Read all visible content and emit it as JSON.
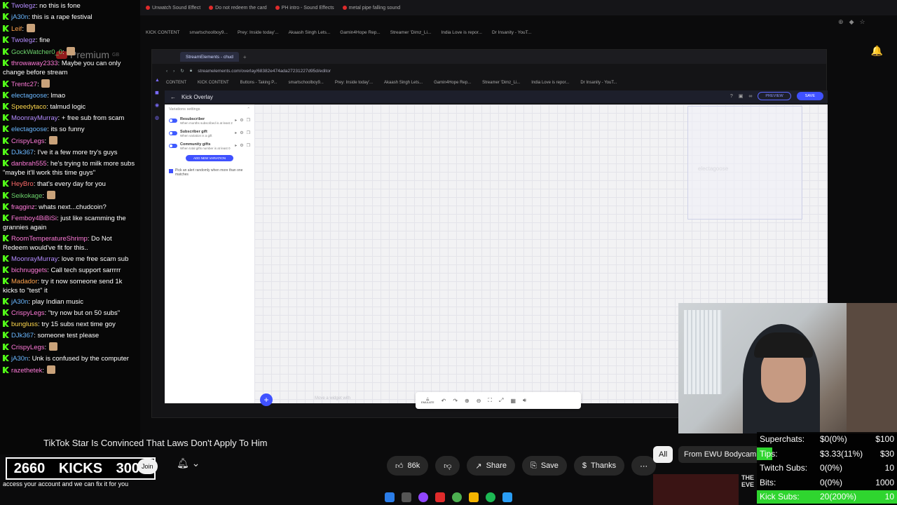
{
  "outer_browser": {
    "tabs": [
      "Unwatch Sound Effect",
      "Do not redeem the card",
      "PH intro - Sound Effects",
      "metal pipe falling sound"
    ],
    "bookmarks": [
      "KICK CONTENT",
      "smartschoolboy9...",
      "Prey: Inside today'...",
      "Akaash Singh Lets...",
      "Gamin4Hope Rep...",
      "Streamer 'Dimz_Li...",
      "India Love is repor...",
      "Dr Insanity - YouT..."
    ],
    "youtube_premium": "Premium",
    "youtube_region": "GB"
  },
  "inner_browser": {
    "tab_title": "StreamElements - chud",
    "url": "streamelements.com/overlay/68382e474ada27231227d95d/editor",
    "bookmarks": [
      "CONTENT",
      "KICK CONTENT",
      "Buttons - Taking P...",
      "smartschoolboy9...",
      "Prey: Inside today'...",
      "Akaash Singh Lets...",
      "Gamin4Hope Rep...",
      "Streamer 'Dimz_Li...",
      "India Love is repor...",
      "Dr Insanity - YouT..."
    ]
  },
  "editor": {
    "title": "Kick Overlay",
    "preview_label": "PREVIEW",
    "save_label": "SAVE",
    "panel_title": "Variations settings",
    "variations": [
      {
        "name": "Resubscriber",
        "desc": "When months subscribed is at least 2"
      },
      {
        "name": "Subscriber gift",
        "desc": "When variation is a gift"
      },
      {
        "name": "Community gifts",
        "desc": "When total gifts number is at least 0"
      }
    ],
    "add_variation_label": "ADD NEW VARIATION",
    "pick_random_label": "Pick an alert randomly when more than one matches",
    "widget_name": "electagoose",
    "canvas_hint": "Move a widget with",
    "emulate_label": "EMULATE"
  },
  "chat": [
    {
      "user": "Twolegz",
      "color": "#b48cff",
      "text": "no this is fone"
    },
    {
      "user": "jA30n",
      "color": "#6ab7ff",
      "text": "this is a rape festival"
    },
    {
      "user": "Leif",
      "color": "#ffa24d",
      "text": ""
    },
    {
      "user": "Twolegz",
      "color": "#b48cff",
      "text": "fine"
    },
    {
      "user": "GockWatcher0_0",
      "color": "#6cd36c",
      "text": ""
    },
    {
      "user": "throwaway2333",
      "color": "#ff7ad9",
      "text": "Maybe you can only change before stream"
    },
    {
      "user": "Trentc27",
      "color": "#ff7ad9",
      "text": ""
    },
    {
      "user": "electagoose",
      "color": "#6ab7ff",
      "text": "lmao"
    },
    {
      "user": "Speedytaco",
      "color": "#ffd84d",
      "text": "talmud logic"
    },
    {
      "user": "MoonrayMurray",
      "color": "#b48cff",
      "text": "+ free sub from scam"
    },
    {
      "user": "electagoose",
      "color": "#6ab7ff",
      "text": "its so funny"
    },
    {
      "user": "CrispyLegs",
      "color": "#ff7ad9",
      "text": ""
    },
    {
      "user": "DJk367",
      "color": "#6ab7ff",
      "text": "I've it a few more try's guys"
    },
    {
      "user": "danbrah555",
      "color": "#ff7ad9",
      "text": "he's trying to milk more subs \"maybe it'll work this time guys\""
    },
    {
      "user": "HeyBro",
      "color": "#ff6b6b",
      "text": "that's every day for you"
    },
    {
      "user": "Seikokage",
      "color": "#6cd36c",
      "text": ""
    },
    {
      "user": "fragginz",
      "color": "#ff7ad9",
      "text": "whats next...chudcoin?"
    },
    {
      "user": "Femboy4BiBiSi",
      "color": "#ff7ad9",
      "text": "just like scamming the grannies again"
    },
    {
      "user": "RoomTemperatureShrimp",
      "color": "#ff7ad9",
      "text": "Do Not Redeem would've fit for this.."
    },
    {
      "user": "MoonrayMurray",
      "color": "#b48cff",
      "text": "love me free scam sub"
    },
    {
      "user": "bichnuggets",
      "color": "#ff7ad9",
      "text": "Call tech support sarrrrr"
    },
    {
      "user": "Madador",
      "color": "#ffa24d",
      "text": "try it now someone send 1k kicks to \"test\" it"
    },
    {
      "user": "jA30n",
      "color": "#6ab7ff",
      "text": "play Indian music"
    },
    {
      "user": "CrispyLegs",
      "color": "#ff7ad9",
      "text": "\"try now but on 50 subs\""
    },
    {
      "user": "bungluss",
      "color": "#ffd84d",
      "text": "try 15 subs next time goy"
    },
    {
      "user": "DJk367",
      "color": "#6ab7ff",
      "text": "someone test please"
    },
    {
      "user": "CrispyLegs",
      "color": "#ff7ad9",
      "text": ""
    },
    {
      "user": "jA30n",
      "color": "#6ab7ff",
      "text": "Unk is confused by the computer"
    },
    {
      "user": "razethetek",
      "color": "#ff7ad9",
      "text": ""
    }
  ],
  "kicks": {
    "current": "2660",
    "label": "KICKS",
    "goal": "3000"
  },
  "chat_bottom": "access your account and we can fix it for you",
  "youtube": {
    "video_title": "TikTok Star Is Convinced That Laws Don't Apply To Him",
    "join_label": "Join",
    "likes": "86k",
    "share_label": "Share",
    "save_label": "Save",
    "thanks_label": "Thanks",
    "chips": [
      "All",
      "From EWU Bodycam"
    ],
    "thumb_text": "THE\nEVE"
  },
  "goals": [
    {
      "label": "Superchats:",
      "value": "$0(0%)",
      "target": "$100",
      "fill": 0
    },
    {
      "label": "Tips:",
      "value": "$3.33(11%)",
      "target": "$30",
      "fill": 0.11
    },
    {
      "label": "Twitch Subs:",
      "value": "0(0%)",
      "target": "10",
      "fill": 0
    },
    {
      "label": "Bits:",
      "value": "0(0%)",
      "target": "1000",
      "fill": 0
    },
    {
      "label": "Kick Subs:",
      "value": "20(200%)",
      "target": "10",
      "fill": 1
    }
  ],
  "colors": {
    "kick_green": "#53fc18",
    "se_blue": "#3f51ff",
    "goal_green": "#2fd52f"
  }
}
